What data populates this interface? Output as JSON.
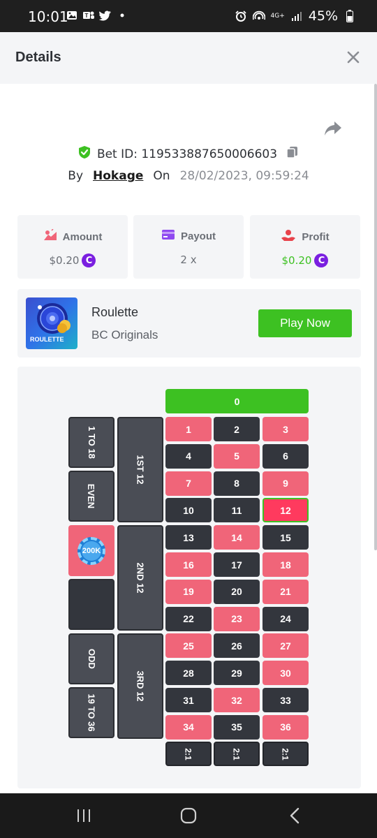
{
  "status_bar": {
    "time": "10:01",
    "battery": "45%",
    "network": "4G+"
  },
  "header": {
    "title": "Details"
  },
  "bet": {
    "id_label": "Bet ID: 119533887650006603",
    "by_label": "By",
    "user": "Hokage",
    "on_label": "On",
    "datetime": "28/02/2023, 09:59:24"
  },
  "stats": {
    "amount": {
      "label": "Amount",
      "value": "$0.20"
    },
    "payout": {
      "label": "Payout",
      "value": "2 x"
    },
    "profit": {
      "label": "Profit",
      "value": "$0.20"
    }
  },
  "game": {
    "name": "Roulette",
    "provider": "BC Originals",
    "thumb_text": "ROULETTE",
    "play_label": "Play Now"
  },
  "roulette": {
    "zero": "0",
    "rows": [
      [
        {
          "n": "1",
          "c": "red"
        },
        {
          "n": "2",
          "c": "black"
        },
        {
          "n": "3",
          "c": "red"
        }
      ],
      [
        {
          "n": "4",
          "c": "black"
        },
        {
          "n": "5",
          "c": "red"
        },
        {
          "n": "6",
          "c": "black"
        }
      ],
      [
        {
          "n": "7",
          "c": "red"
        },
        {
          "n": "8",
          "c": "black"
        },
        {
          "n": "9",
          "c": "red"
        }
      ],
      [
        {
          "n": "10",
          "c": "black"
        },
        {
          "n": "11",
          "c": "black"
        },
        {
          "n": "12",
          "c": "sel"
        }
      ],
      [
        {
          "n": "13",
          "c": "black"
        },
        {
          "n": "14",
          "c": "red"
        },
        {
          "n": "15",
          "c": "black"
        }
      ],
      [
        {
          "n": "16",
          "c": "red"
        },
        {
          "n": "17",
          "c": "black"
        },
        {
          "n": "18",
          "c": "red"
        }
      ],
      [
        {
          "n": "19",
          "c": "red"
        },
        {
          "n": "20",
          "c": "black"
        },
        {
          "n": "21",
          "c": "red"
        }
      ],
      [
        {
          "n": "22",
          "c": "black"
        },
        {
          "n": "23",
          "c": "red"
        },
        {
          "n": "24",
          "c": "black"
        }
      ],
      [
        {
          "n": "25",
          "c": "red"
        },
        {
          "n": "26",
          "c": "black"
        },
        {
          "n": "27",
          "c": "red"
        }
      ],
      [
        {
          "n": "28",
          "c": "black"
        },
        {
          "n": "29",
          "c": "black"
        },
        {
          "n": "30",
          "c": "red"
        }
      ],
      [
        {
          "n": "31",
          "c": "black"
        },
        {
          "n": "32",
          "c": "red"
        },
        {
          "n": "33",
          "c": "black"
        }
      ],
      [
        {
          "n": "34",
          "c": "red"
        },
        {
          "n": "35",
          "c": "black"
        },
        {
          "n": "36",
          "c": "red"
        }
      ]
    ],
    "dozens": [
      "1ST 12",
      "2ND 12",
      "3RD 12"
    ],
    "outside": [
      "1 TO 18",
      "EVEN",
      "",
      "",
      "ODD",
      "19 TO 36"
    ],
    "column_bets": [
      "2:1",
      "2:1",
      "2:1"
    ],
    "chip_label": "200K"
  },
  "colors": {
    "red": "#f06579",
    "black": "#33363d",
    "green": "#3dc122",
    "coin": "#7a1fe0"
  }
}
